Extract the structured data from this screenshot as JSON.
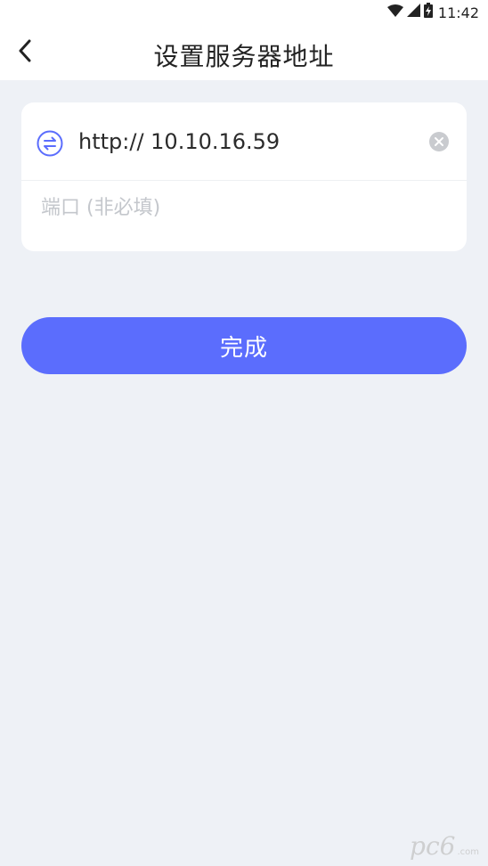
{
  "status_bar": {
    "time": "11:42",
    "icons": [
      "wifi-icon",
      "signal-icon",
      "battery-charging-icon"
    ]
  },
  "nav": {
    "title": "设置服务器地址",
    "back_icon": "chevron-left-icon"
  },
  "form": {
    "url_icon": "swap-arrows-icon",
    "url_value": "http:// 10.10.16.59",
    "clear_icon": "clear-circle-icon",
    "port_value": "",
    "port_placeholder": "端口 (非必填)"
  },
  "actions": {
    "done_label": "完成"
  },
  "watermark": {
    "main": "pc6",
    "sub": ".com"
  },
  "colors": {
    "accent": "#5b6dfd",
    "background": "#eef1f6",
    "card": "#ffffff",
    "placeholder": "#c4c7cc"
  }
}
